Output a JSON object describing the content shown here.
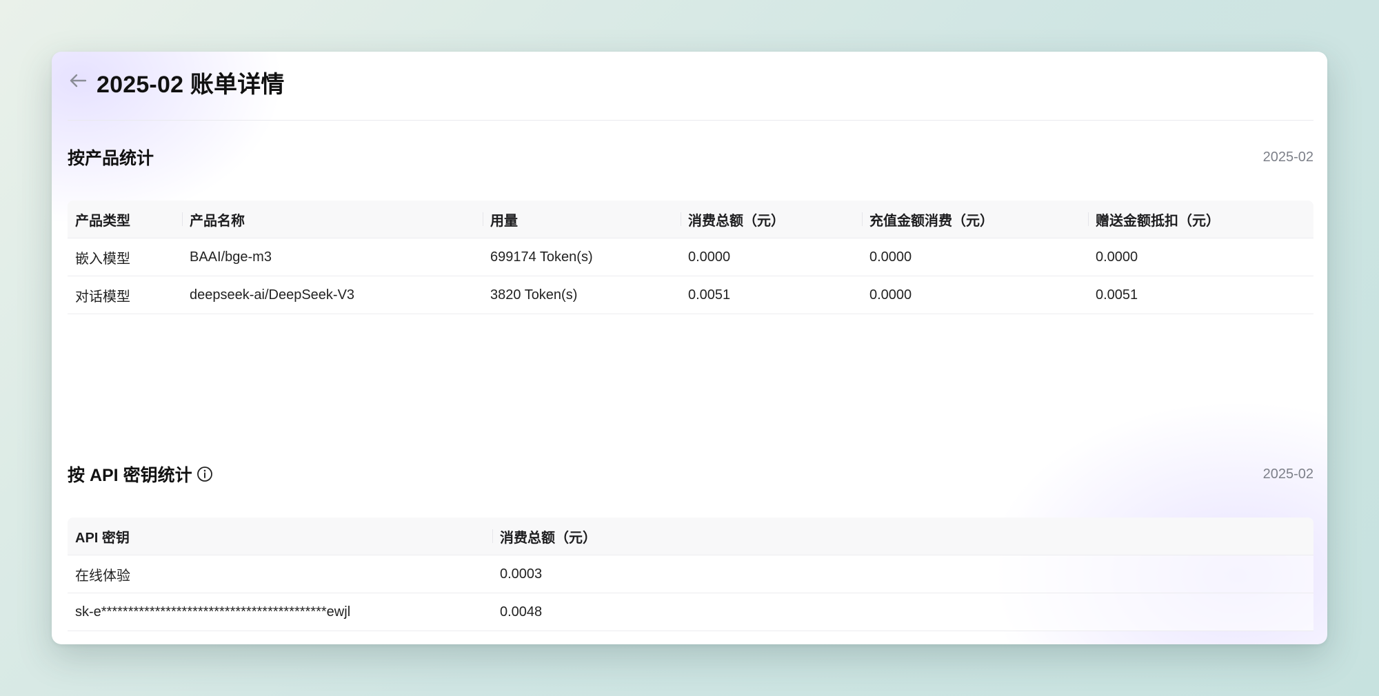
{
  "header": {
    "title": "2025-02 账单详情"
  },
  "by_product": {
    "title": "按产品统计",
    "date": "2025-02",
    "columns": [
      "产品类型",
      "产品名称",
      "用量",
      "消费总额（元）",
      "充值金额消费（元）",
      "赠送金额抵扣（元）"
    ],
    "rows": [
      [
        "嵌入模型",
        "BAAI/bge-m3",
        "699174 Token(s)",
        "0.0000",
        "0.0000",
        "0.0000"
      ],
      [
        "对话模型",
        "deepseek-ai/DeepSeek-V3",
        "3820 Token(s)",
        "0.0051",
        "0.0000",
        "0.0051"
      ]
    ]
  },
  "by_api_key": {
    "title": "按 API 密钥统计",
    "date": "2025-02",
    "columns": [
      "API 密钥",
      "消费总额（元）"
    ],
    "rows": [
      [
        "在线体验",
        "0.0003"
      ],
      [
        "sk-e******************************************ewjl",
        "0.0048"
      ]
    ]
  }
}
